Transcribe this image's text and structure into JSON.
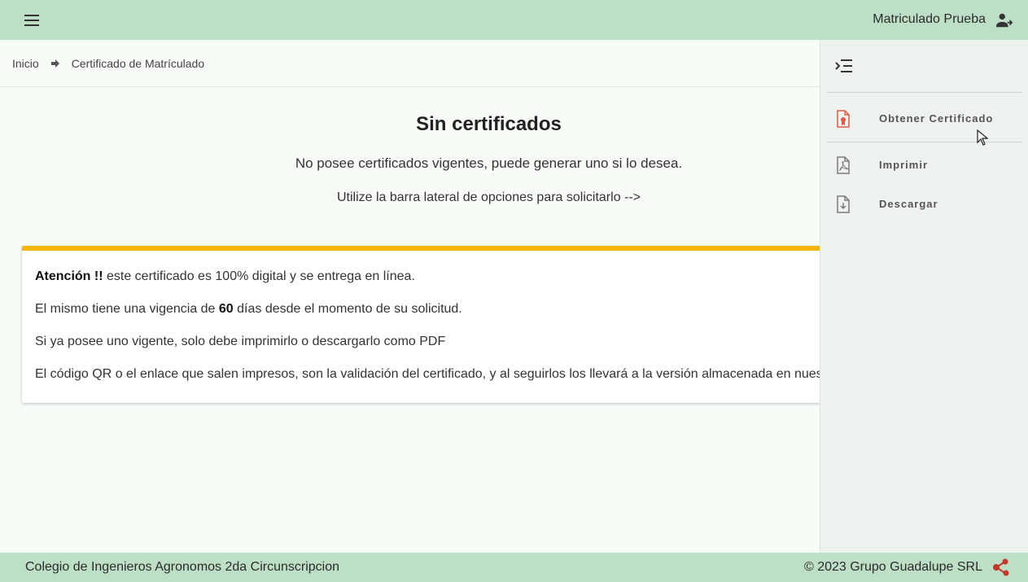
{
  "header": {
    "user_name": "Matriculado Prueba",
    "menu_icon": "menu-icon",
    "user_icon": "user-icon"
  },
  "breadcrumb": {
    "home": "Inicio",
    "current": "Certificado de Matrículado"
  },
  "main": {
    "title": "Sin certificados",
    "subtitle": "No posee certificados vigentes, puede generar uno si lo desea.",
    "hint": "Utilize la barra lateral de opciones para solicitarlo -->"
  },
  "notice": {
    "line1_bold": "Atención !!",
    "line1_rest": " este certificado es 100% digital y se entrega en línea.",
    "line2_pre": "El mismo tiene una vigencia de ",
    "line2_days": "60",
    "line2_post": " días desde el momento de su solicitud.",
    "line3": "Si ya posee uno vigente, solo debe imprimirlo o descargarlo como PDF",
    "line4": "El código QR o el enlace que salen impresos, son la validación del certificado, y al seguirlos los llevará a la versión almacenada en nuestr",
    "accent_color": "#f6b70d"
  },
  "sidebar": {
    "items": [
      {
        "label": "Obtener Certificado",
        "icon": "certificate-icon",
        "color": "#e05a4a"
      },
      {
        "label": "Imprimir",
        "icon": "pdf-file-icon",
        "color": "#7a7a7a"
      },
      {
        "label": "Descargar",
        "icon": "download-file-icon",
        "color": "#7a7a7a"
      }
    ]
  },
  "footer": {
    "left": "Colegio de Ingenieros Agronomos 2da Circunscripcion",
    "right": "© 2023 Grupo Guadalupe SRL",
    "brand_color": "#c0392b"
  },
  "colors": {
    "bar": "#bddfc6",
    "background": "#f7fcf7",
    "sidebar": "#eef2ee"
  }
}
